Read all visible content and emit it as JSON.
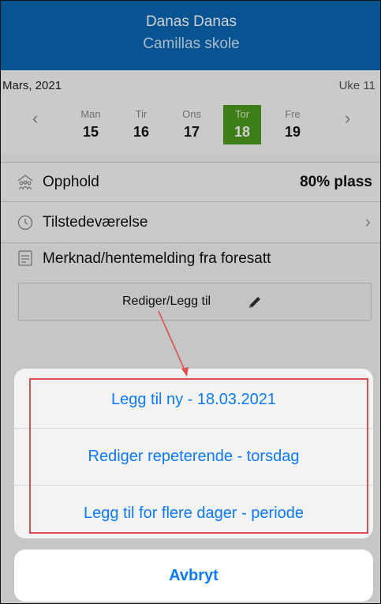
{
  "header": {
    "name": "Danas Danas",
    "school": "Camillas skole"
  },
  "week": {
    "month": "Mars, 2021",
    "week_label": "Uke 11",
    "days": [
      {
        "name": "Man",
        "date": "15"
      },
      {
        "name": "Tir",
        "date": "16"
      },
      {
        "name": "Ons",
        "date": "17"
      },
      {
        "name": "Tor",
        "date": "18"
      },
      {
        "name": "Fre",
        "date": "19"
      }
    ],
    "selected_day": "Tor",
    "prev_icon": "chevron-left-icon",
    "next_icon": "chevron-right-icon"
  },
  "rows": {
    "opphold_label": "Opphold",
    "opphold_value": "80% plass",
    "tilstede_label": "Tilstedeværelse",
    "merknad_label": "Merknad/hentemelding fra foresatt"
  },
  "edit_button": {
    "label": "Rediger/Legg til",
    "icon": "pencil-icon"
  },
  "action_sheet": {
    "options": [
      "Legg til ny - 18.03.2021",
      "Rediger repeterende - torsdag",
      "Legg til for flere dager - periode"
    ],
    "cancel": "Avbryt"
  },
  "colors": {
    "header_bg": "#0a67b3",
    "selected_day_bg": "#4c9a1e",
    "action_text": "#0a7aff",
    "annotation": "#e05050"
  }
}
